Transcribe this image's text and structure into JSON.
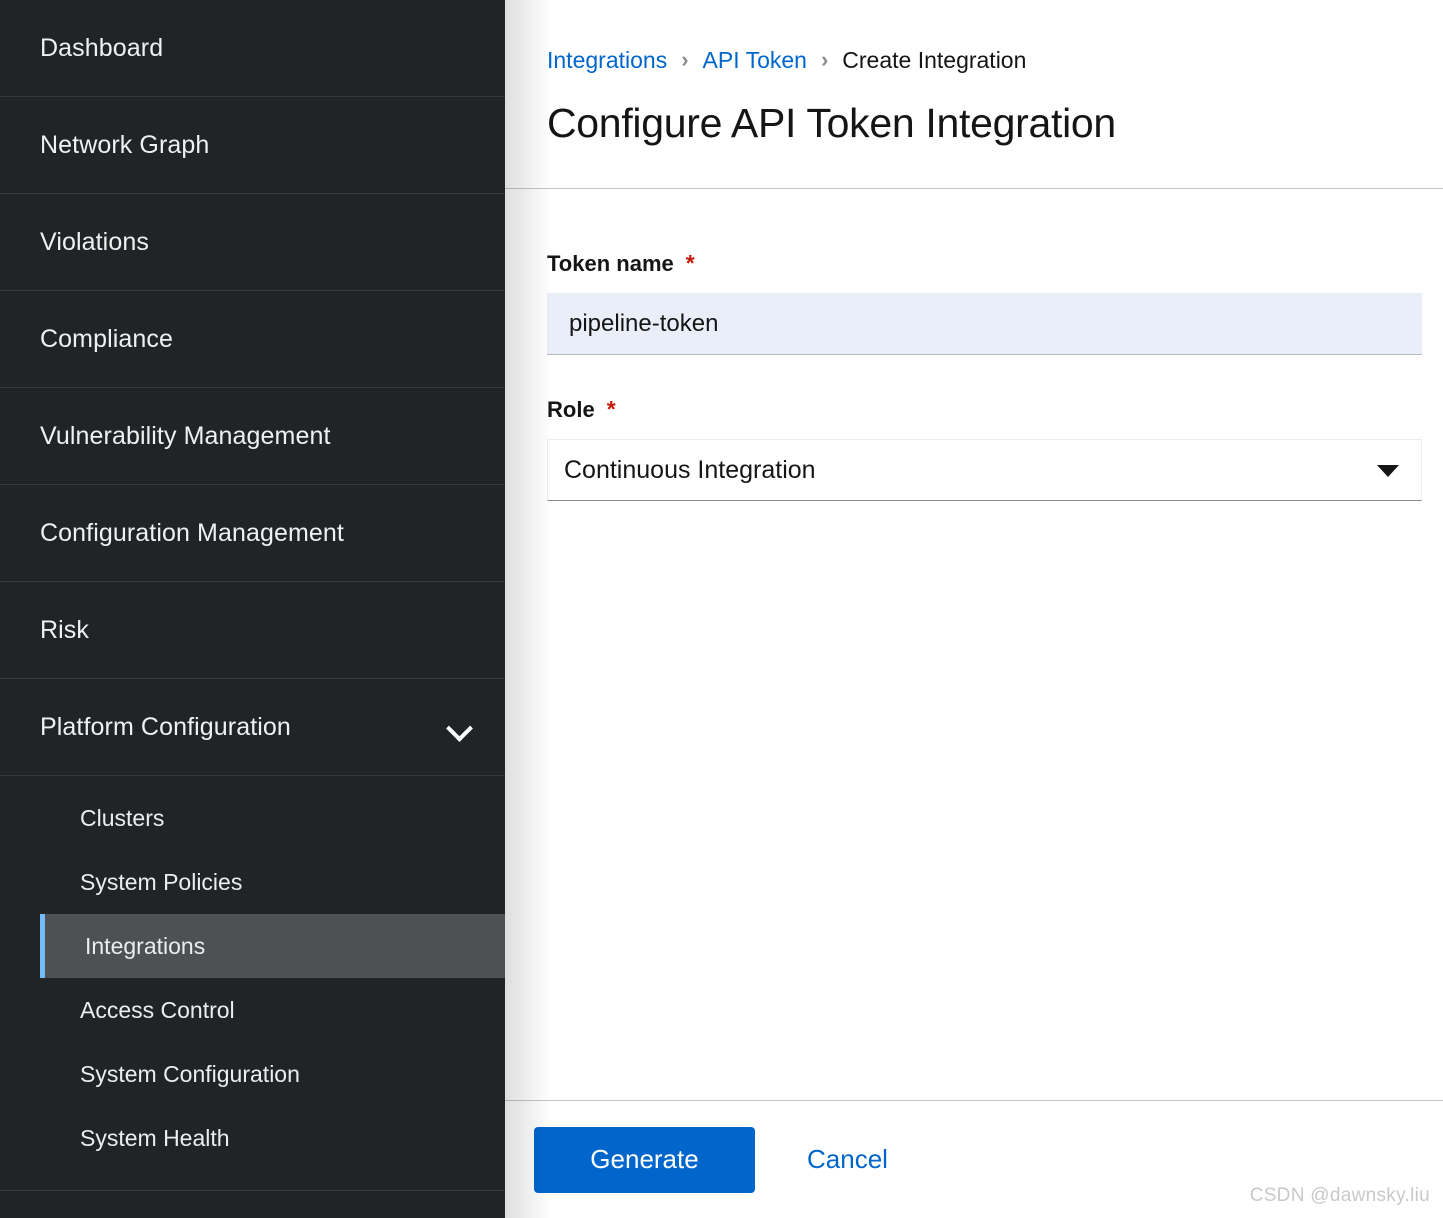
{
  "colors": {
    "sidebar_bg": "#212427",
    "sidebar_active_bg": "#4d5154",
    "sidebar_active_accent": "#73bcf7",
    "link_blue": "#0066cc",
    "required_red": "#c9190b",
    "input_focus_bg": "#e9eef9",
    "text_primary": "#151515"
  },
  "sidebar": {
    "items": [
      {
        "label": "Dashboard",
        "icon": "",
        "expandable": false,
        "active": false
      },
      {
        "label": "Network Graph",
        "icon": "",
        "expandable": false,
        "active": false
      },
      {
        "label": "Violations",
        "icon": "",
        "expandable": false,
        "active": false
      },
      {
        "label": "Compliance",
        "icon": "",
        "expandable": false,
        "active": false
      },
      {
        "label": "Vulnerability Management",
        "icon": "",
        "expandable": false,
        "active": false
      },
      {
        "label": "Configuration Management",
        "icon": "",
        "expandable": false,
        "active": false
      },
      {
        "label": "Risk",
        "icon": "",
        "expandable": false,
        "active": false
      },
      {
        "label": "Platform Configuration",
        "icon": "chevron-down-icon",
        "expandable": true,
        "expanded": true,
        "active": false
      }
    ],
    "subitems": [
      {
        "label": "Clusters",
        "active": false
      },
      {
        "label": "System Policies",
        "active": false
      },
      {
        "label": "Integrations",
        "active": true
      },
      {
        "label": "Access Control",
        "active": false
      },
      {
        "label": "System Configuration",
        "active": false
      },
      {
        "label": "System Health",
        "active": false
      }
    ]
  },
  "header": {
    "breadcrumb": [
      {
        "label": "Integrations",
        "is_link": true
      },
      {
        "label": "API Token",
        "is_link": true
      },
      {
        "label": "Create Integration",
        "is_link": false
      }
    ],
    "breadcrumb_separator": "›",
    "title": "Configure API Token Integration"
  },
  "form": {
    "required_marker": "*",
    "fields": {
      "token_name": {
        "label": "Token name",
        "required": true,
        "value": "pipeline-token",
        "placeholder": ""
      },
      "role": {
        "label": "Role",
        "required": true,
        "selected": "Continuous Integration",
        "caret_icon": "caret-down-icon"
      }
    }
  },
  "footer": {
    "generate_label": "Generate",
    "cancel_label": "Cancel"
  },
  "watermark": {
    "text": "CSDN @dawnsky.liu"
  }
}
